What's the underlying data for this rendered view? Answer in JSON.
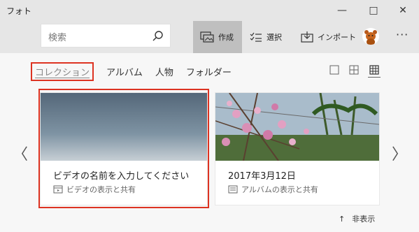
{
  "titlebar": {
    "title": "フォト",
    "min_symbol": "—",
    "max_symbol": "□",
    "close_symbol": "✕"
  },
  "toolbar": {
    "search_placeholder": "検索",
    "create_label": "作成",
    "select_label": "選択",
    "import_label": "インポート",
    "more_symbol": "···"
  },
  "tabs": [
    {
      "label": "コレクション",
      "active": true
    },
    {
      "label": "アルバム",
      "active": false
    },
    {
      "label": "人物",
      "active": false
    },
    {
      "label": "フォルダー",
      "active": false
    }
  ],
  "cards": [
    {
      "title": "ビデオの名前を入力してください",
      "subtitle": "ビデオの表示と共有",
      "icon": "video-icon"
    },
    {
      "title": "2017年3月12日",
      "subtitle": "アルバムの表示と共有",
      "icon": "album-icon"
    }
  ],
  "footer": {
    "hide_label": "非表示",
    "hide_symbol": "↑"
  },
  "nav": {
    "prev_symbol": "〈",
    "next_symbol": "〉"
  },
  "colors": {
    "highlight": "#dd3322",
    "titlebar": "#e6e6e6",
    "active_button": "#bfbfbf"
  }
}
